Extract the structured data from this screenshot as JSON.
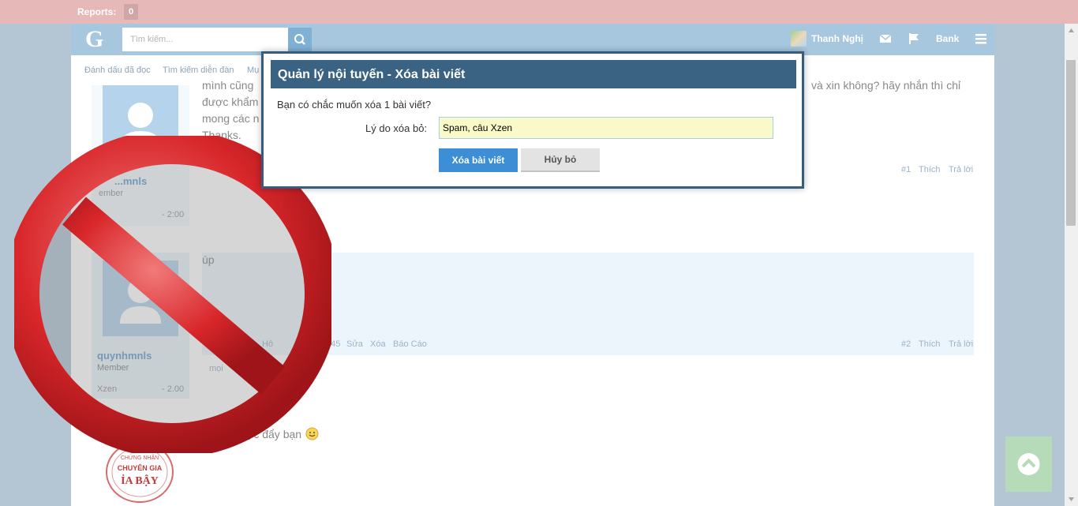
{
  "topbar": {
    "reports_label": "Reports:",
    "reports_count": "0"
  },
  "navbar": {
    "logo": "G",
    "search_placeholder": "Tìm kiếm...",
    "user_name": "Thanh Nghị",
    "bank_label": "Bank",
    "icons": [
      "search-icon",
      "mail-icon",
      "flag-icon",
      "menu-icon"
    ]
  },
  "subnav": {
    "items": [
      "Đánh dấu đã đọc",
      "Tìm kiếm diễn đàn",
      "Mụ"
    ]
  },
  "posts": [
    {
      "text_lines": [
        "mình cũng",
        "được khẩm",
        "mong các n",
        "Thanks."
      ],
      "right_snippet": "và xin không? hãy nhắn thì chỉ",
      "username_fragment": "...mnls",
      "role": "ember",
      "stat": "- 2:00",
      "actions": [
        "#1",
        "Thích",
        "Trả lời"
      ]
    },
    {
      "text": "úp",
      "username": "quynhmnls",
      "role": "Member",
      "stat_label": "Xzen",
      "stat": "- 2.00",
      "edit_actions": [
        "Sửa",
        "Xóa",
        "Báo Cáo"
      ],
      "meta_fragment": "ls, Hô",
      "time_fragment": "3:45",
      "more_fragment": "mọi",
      "actions": [
        "#2",
        "Thích",
        "Trả lời"
      ]
    },
    {
      "text": "được đẩy bạn"
    }
  ],
  "stamp": {
    "line1": "CHỨNG NHẬN",
    "line2": "CHUYÊN GIA",
    "line3": "ỈA BẬY"
  },
  "modal": {
    "title": "Quản lý nội tuyến - Xóa bài viết",
    "question": "Bạn có chắc muốn xóa 1 bài viết?",
    "reason_label": "Lý do xóa bỏ:",
    "reason_value": "Spam, câu Xzen",
    "delete_button": "Xóa bài viết",
    "cancel_button": "Hủy bỏ"
  },
  "colors": {
    "modal_header": "#3a6383",
    "primary_button": "#3d8fd5",
    "forbidden_red": "#d8262a"
  }
}
